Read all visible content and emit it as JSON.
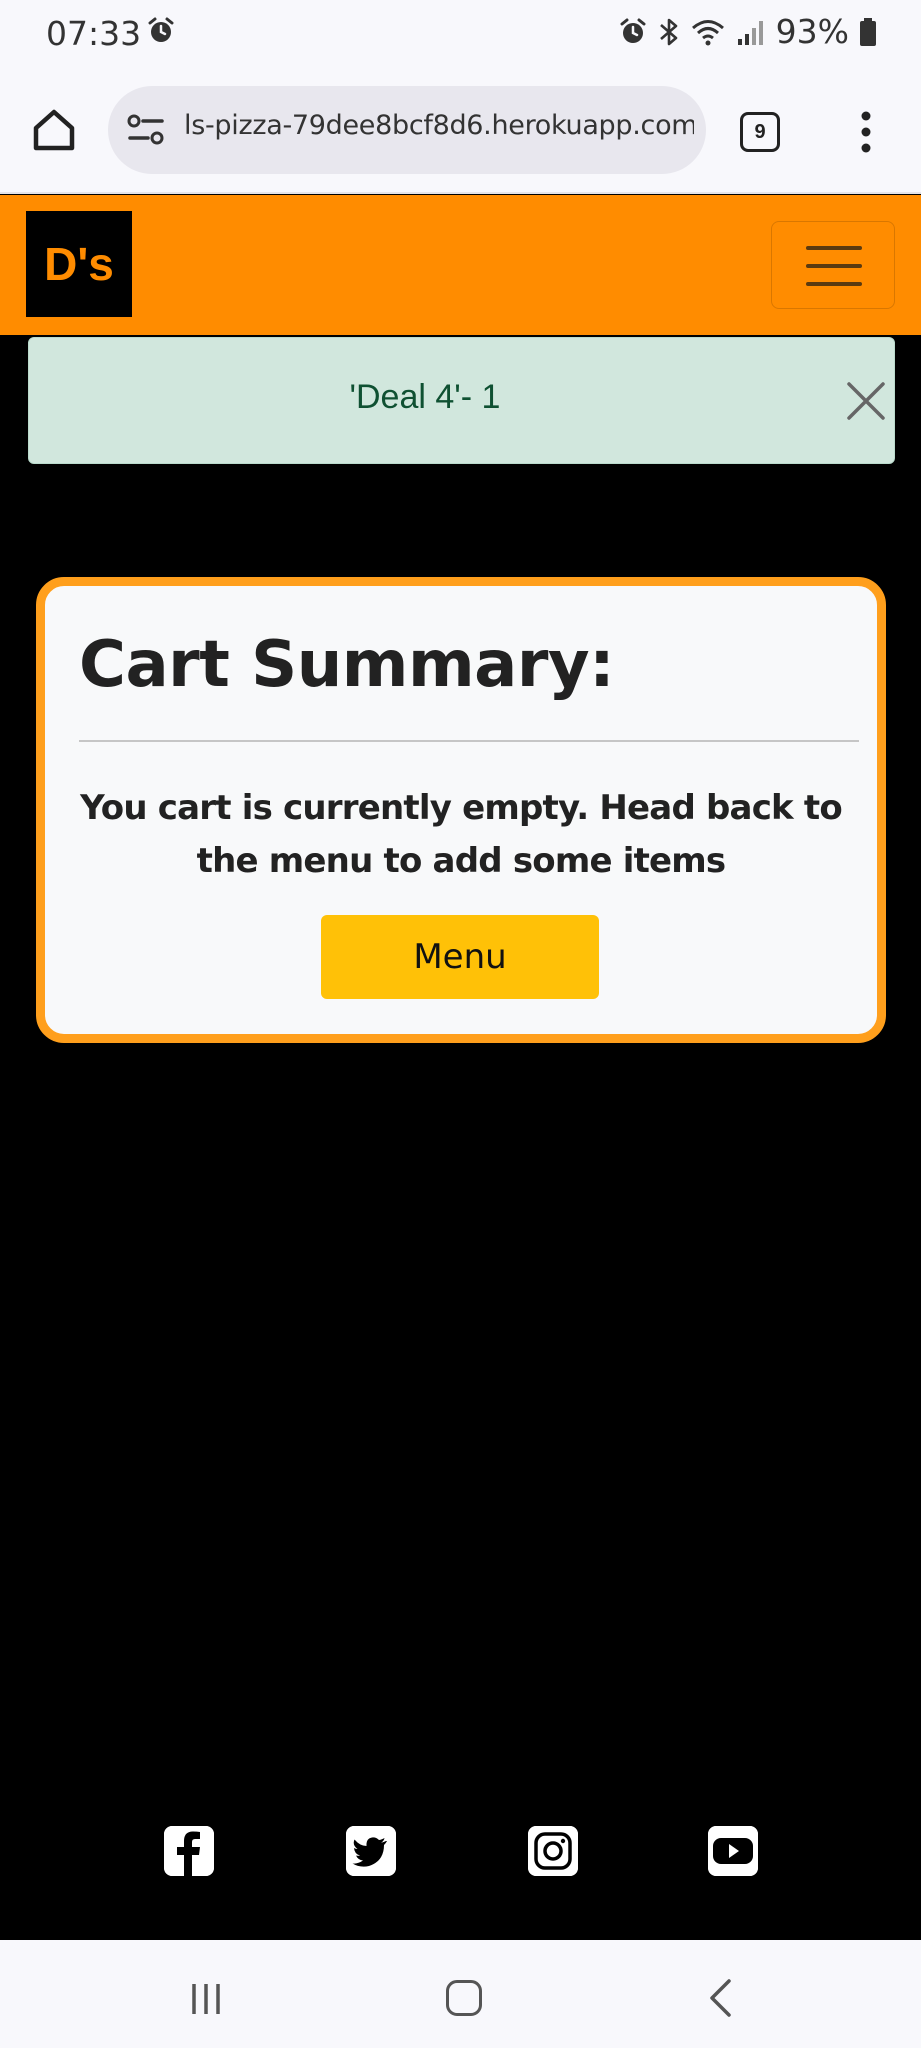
{
  "status_bar": {
    "time": "07:33",
    "battery": "93%",
    "icons": [
      "alarm-icon",
      "bluetooth-icon",
      "wifi-icon",
      "signal-icon",
      "battery-icon"
    ]
  },
  "browser": {
    "url": "ls-pizza-79dee8bcf8d6.herokuapp.com",
    "tab_count": "9"
  },
  "site": {
    "logo_text": "D's",
    "brand_color": "#ff8c00"
  },
  "alert": {
    "message": "'Deal 4'- 1"
  },
  "cart": {
    "title": "Cart Summary:",
    "empty_message": "You cart is currently empty. Head back to the menu to add some items",
    "menu_button": "Menu"
  },
  "footer": {
    "socials": [
      "facebook-icon",
      "twitter-icon",
      "instagram-icon",
      "youtube-icon"
    ]
  }
}
